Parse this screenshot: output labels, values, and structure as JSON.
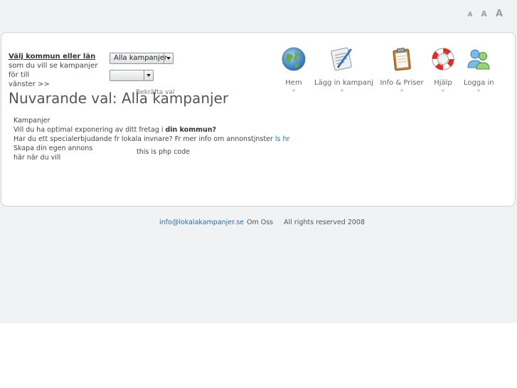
{
  "font_controls": {
    "small": "A",
    "medium": "A",
    "large": "A"
  },
  "region": {
    "heading": "Välj kommun eller län",
    "line1": "som du vill se kampanjer för till",
    "line2": "vänster >>"
  },
  "selects": {
    "kampanjer_value": "Alla kampanjer",
    "secondary_value": ""
  },
  "confirm_label": "Bekräfta val",
  "page_heading": "Nuvarande val: Alla kampanjer",
  "nav": {
    "items": [
      {
        "label": "Hem",
        "icon": "globe-icon"
      },
      {
        "label": "Lägg in kampanj",
        "icon": "document-pen-icon"
      },
      {
        "label": "Info & Priser",
        "icon": "clipboard-icon"
      },
      {
        "label": "Hjälp",
        "icon": "lifebuoy-icon"
      },
      {
        "label": "Logga in",
        "icon": "users-icon"
      }
    ]
  },
  "content": {
    "line1": "Kampanjer",
    "line2_prefix": "Vill du ha optimal exponering av ditt fretag i ",
    "line2_bold": "din kommun?",
    "line3_prefix": "Har du ett specialerbjudande fr lokala invnare? Fr mer info om annonstjnster ",
    "line3_link": "ls hr",
    "line4": "Skapa din egen annons",
    "line5": "här när du vill",
    "php": "this is php code"
  },
  "footer": {
    "email": "info@lokalakampanjer.se",
    "about": "Om Oss",
    "rights": "All rights reserved 2008"
  },
  "colors": {
    "link": "#2e6da4",
    "page_bg": "#f0f2f3",
    "panel_border": "#cfd3d6"
  }
}
